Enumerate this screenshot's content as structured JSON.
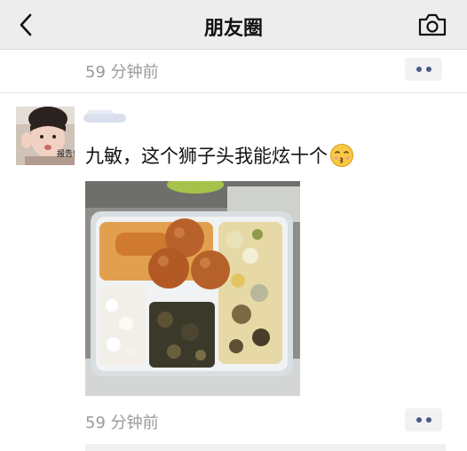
{
  "nav": {
    "title": "朋友圈",
    "back_icon": "chevron-left-icon",
    "camera_icon": "camera-icon"
  },
  "previous_post": {
    "time": "59 分钟前",
    "more_icon": "more-dots-icon"
  },
  "post": {
    "avatar_sticker_text": "报告!",
    "text": "九敏，这个狮子头我能炫十个",
    "emoji": "kissing-face-emoji",
    "photo": "boxed-lunch-photo",
    "time": "59 分钟前",
    "more_icon": "more-dots-icon"
  },
  "colors": {
    "nav_bg": "#ededed",
    "timestamp": "#9a9a9a",
    "more_dot": "#4a5a86",
    "more_bg": "#f2f2f4"
  }
}
